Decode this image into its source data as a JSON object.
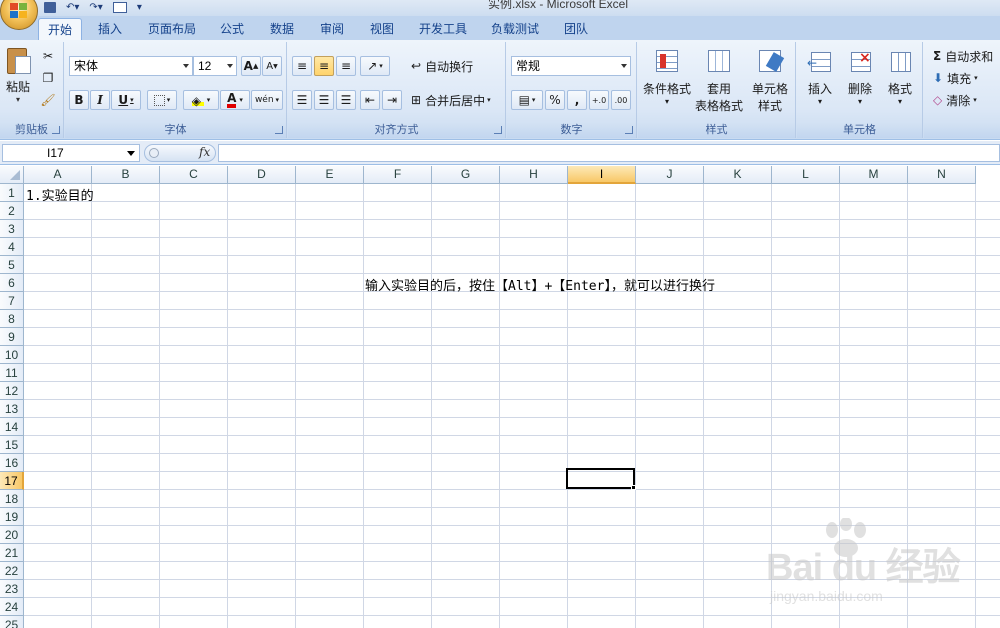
{
  "window": {
    "title": "实例.xlsx - Microsoft Excel"
  },
  "tabs": [
    {
      "label": "开始",
      "active": true
    },
    {
      "label": "插入"
    },
    {
      "label": "页面布局"
    },
    {
      "label": "公式"
    },
    {
      "label": "数据"
    },
    {
      "label": "审阅"
    },
    {
      "label": "视图"
    },
    {
      "label": "开发工具"
    },
    {
      "label": "负载测试"
    },
    {
      "label": "团队"
    }
  ],
  "ribbon": {
    "clipboard": {
      "label": "剪贴板",
      "paste": "粘贴"
    },
    "font": {
      "label": "字体",
      "font_name": "宋体",
      "font_size": "12",
      "bold": "B",
      "italic": "I",
      "underline": "U",
      "grow": "A",
      "shrink": "A",
      "font_color_letter": "A",
      "phonetic": "wén"
    },
    "alignment": {
      "label": "对齐方式",
      "wrap_text": "自动换行",
      "merge_center": "合并后居中"
    },
    "number": {
      "label": "数字",
      "format": "常规",
      "percent": "%",
      "comma": ",",
      "inc_decimal": "+.0",
      "dec_decimal": ".00"
    },
    "styles": {
      "label": "样式",
      "conditional": "条件格式",
      "table_format_1": "套用",
      "table_format_2": "表格格式",
      "cell_styles_1": "单元格",
      "cell_styles_2": "样式"
    },
    "cells": {
      "label": "单元格",
      "insert": "插入",
      "delete": "删除",
      "format": "格式"
    },
    "editing": {
      "autosum": "自动求和",
      "fill": "填充",
      "clear": "清除"
    }
  },
  "formula_bar": {
    "name_box": "I17",
    "fx": "fx",
    "content": ""
  },
  "grid": {
    "columns": [
      "A",
      "B",
      "C",
      "D",
      "E",
      "F",
      "G",
      "H",
      "I",
      "J",
      "K",
      "L",
      "M",
      "N"
    ],
    "rows": [
      "1",
      "2",
      "3",
      "4",
      "5",
      "6",
      "7",
      "8",
      "9",
      "10",
      "11",
      "12",
      "13",
      "14",
      "15",
      "16",
      "17",
      "18",
      "19",
      "20",
      "21",
      "22",
      "23",
      "24",
      "25"
    ],
    "selected_column": "I",
    "selected_row": "17",
    "cells": {
      "A1": "1.实验目的",
      "F6": "输入实验目的后，按住【Alt】+【Enter】，就可以进行换行"
    }
  },
  "watermark": {
    "brand": "Bai du 经验",
    "url": "jingyan.baidu.com"
  },
  "colors": {
    "ribbon_bg": "#dbe7f6",
    "selection_header": "#f8c868",
    "grid_line": "#d0d7e5",
    "tab_text": "#15428b"
  }
}
